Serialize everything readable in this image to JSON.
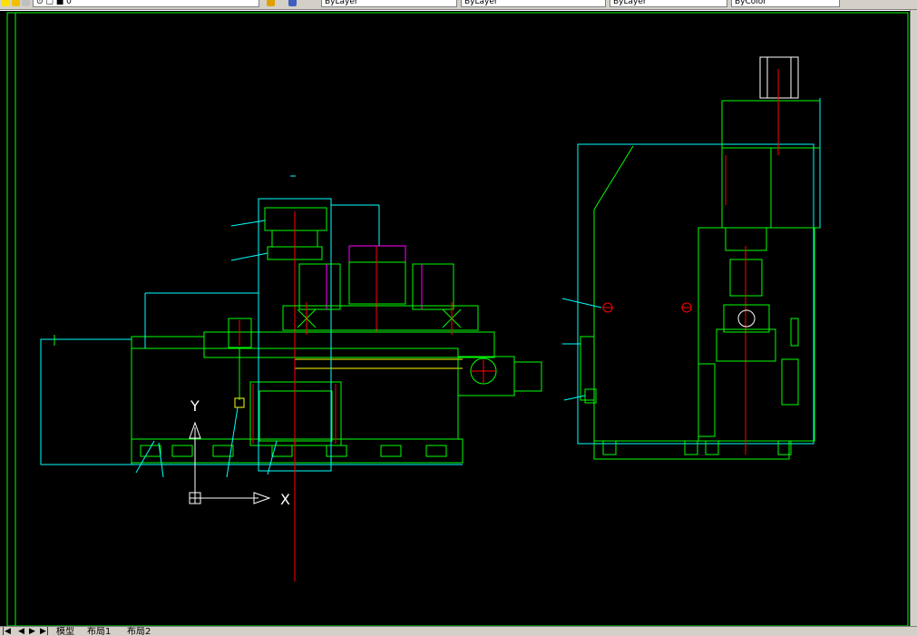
{
  "toolbar": {
    "layer_field": "⊙ ▢ ■ 0",
    "style_field": "ByLayer",
    "lineweight_field": "ByLayer",
    "color_field": "ByLayer",
    "extra_field": "ByColor"
  },
  "icons": {
    "lightbulb": "lightbulb-icon",
    "sun": "sun-icon",
    "lock": "lock-icon",
    "layer_props": "layer-properties-icon",
    "layer_prev": "layer-previous-icon"
  },
  "ucs": {
    "y_label": "Y",
    "x_label": "X"
  },
  "tabs": {
    "nav_first": "|◀",
    "nav_prev": "◀",
    "nav_next": "▶",
    "nav_last": "▶|",
    "model": "模型",
    "layout1": "布局1",
    "layout2": "布局2"
  },
  "colors": {
    "canvas": "#000000",
    "drawing_green": "#00ff00",
    "drawing_cyan": "#00ffff",
    "drawing_red": "#ff0000",
    "drawing_magenta": "#ff00ff",
    "drawing_yellow": "#ffff00",
    "drawing_white": "#ffffff"
  }
}
